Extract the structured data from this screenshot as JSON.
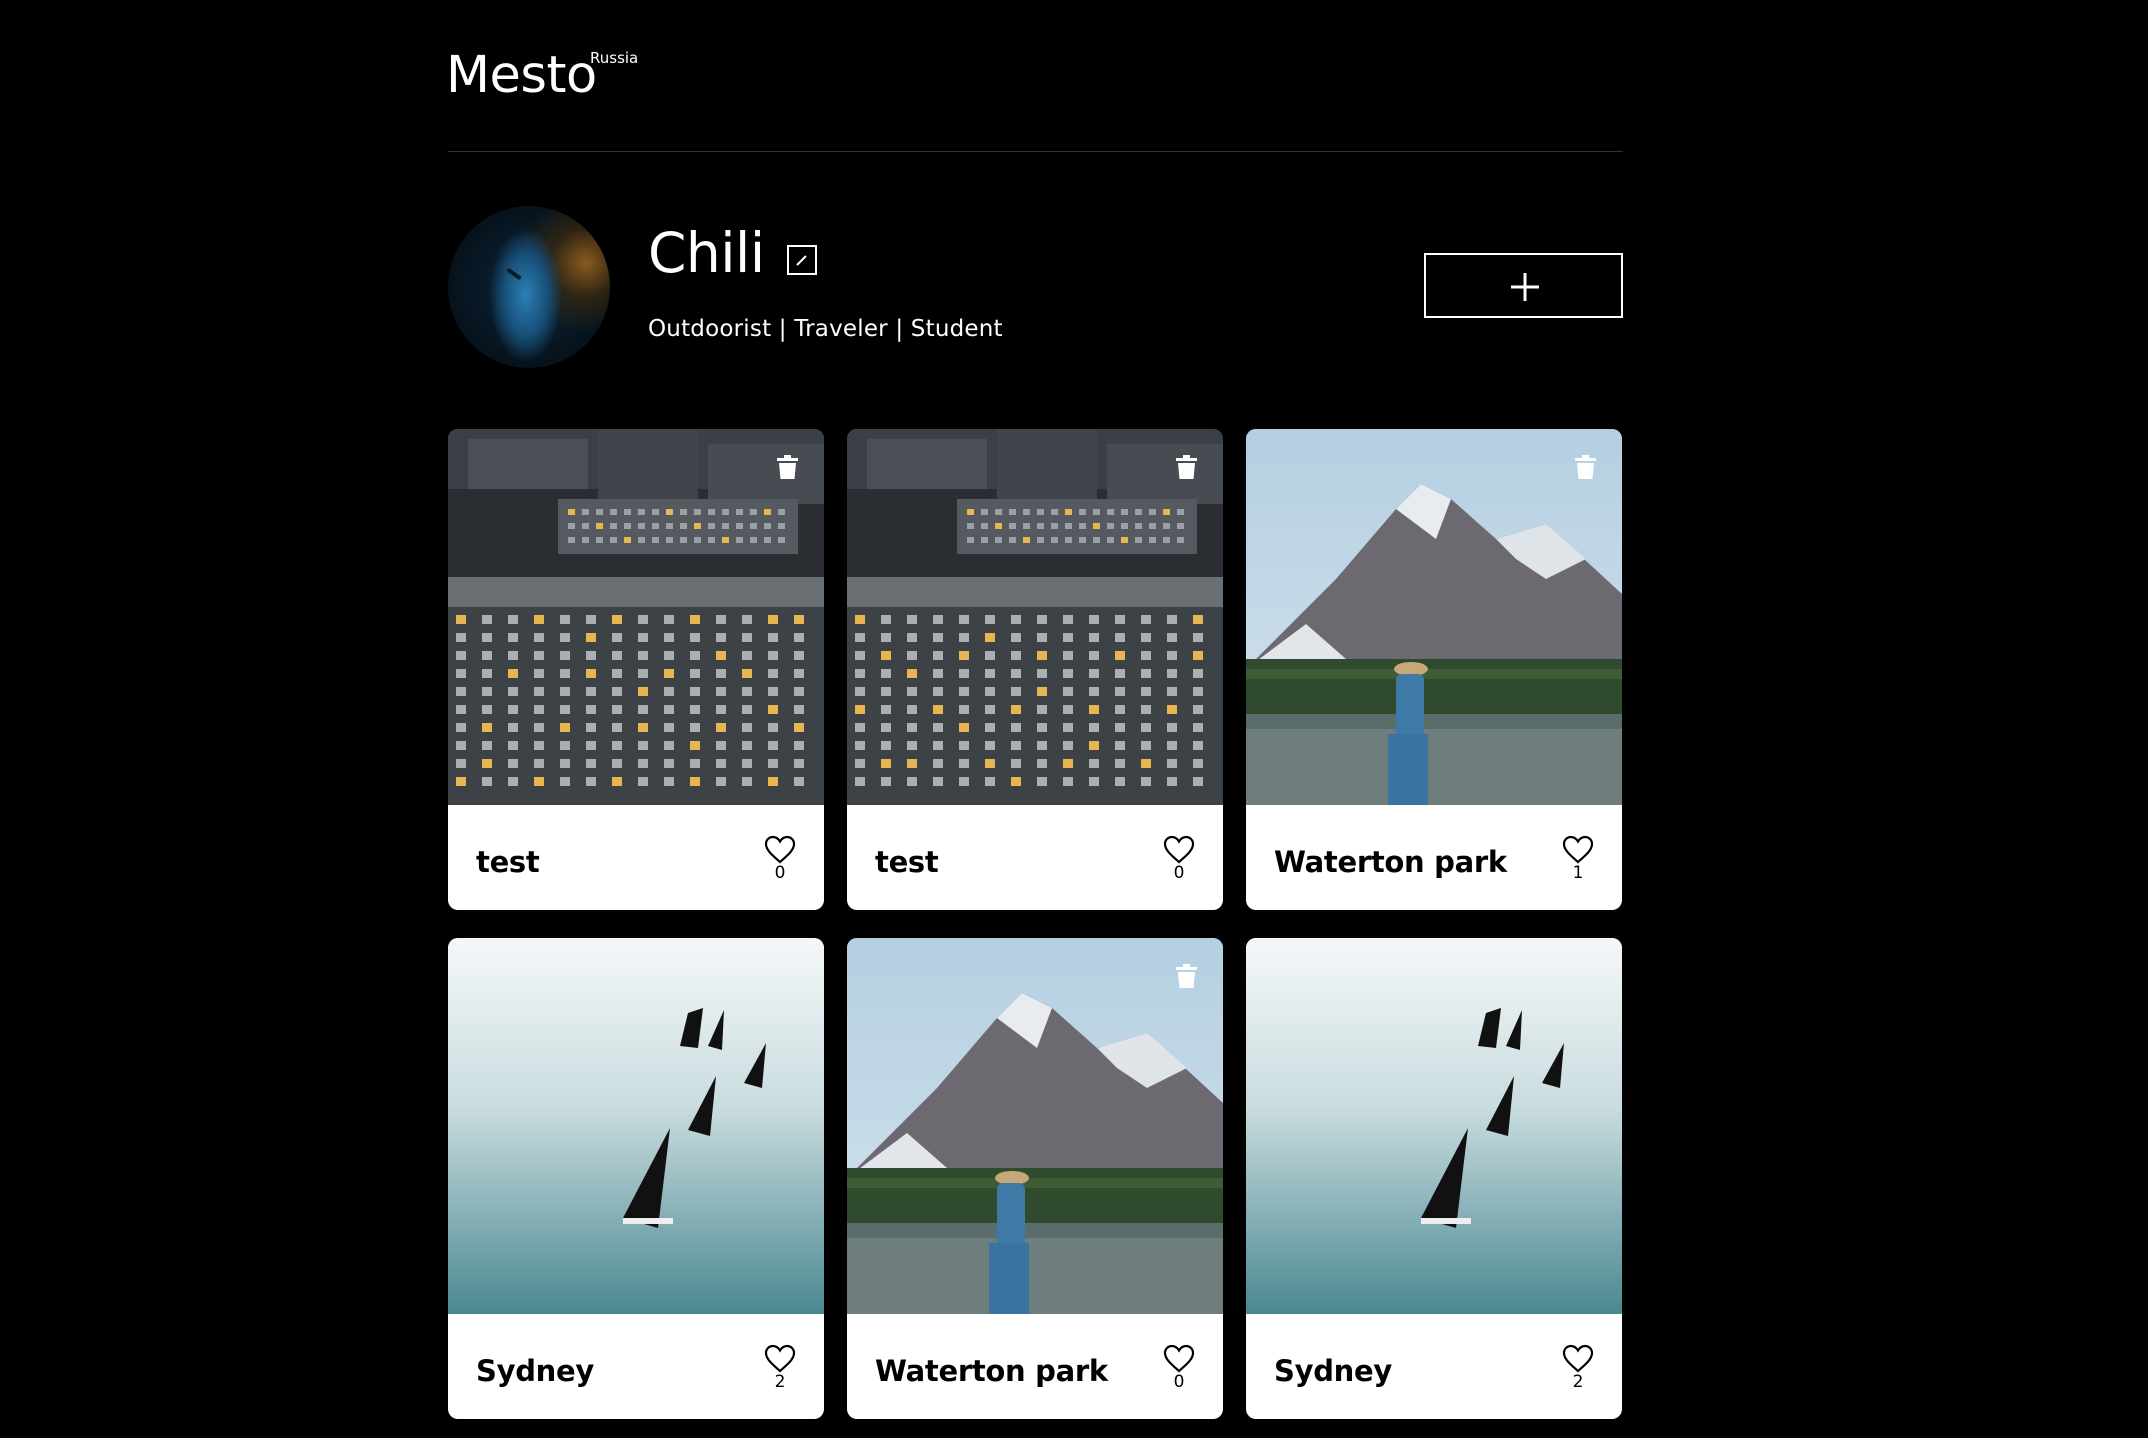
{
  "header": {
    "logo": "Mesto",
    "logo_sup": "Russia"
  },
  "profile": {
    "name": "Chili",
    "about": "Outdoorist | Traveler | Student"
  },
  "cards": [
    {
      "title": "test",
      "likes": "0",
      "image": "city-buildings",
      "deletable": true
    },
    {
      "title": "test",
      "likes": "0",
      "image": "city-buildings",
      "deletable": true
    },
    {
      "title": "Waterton park",
      "likes": "1",
      "image": "mountain-lake",
      "deletable": true
    },
    {
      "title": "Sydney",
      "likes": "2",
      "image": "sailboats",
      "deletable": false
    },
    {
      "title": "Waterton park",
      "likes": "0",
      "image": "mountain-lake",
      "deletable": true
    },
    {
      "title": "Sydney",
      "likes": "2",
      "image": "sailboats",
      "deletable": false
    }
  ],
  "icons": {
    "edit": "pencil-icon",
    "add": "plus-icon",
    "delete": "trash-icon",
    "like": "heart-icon"
  },
  "colors": {
    "background": "#000000",
    "card": "#ffffff",
    "text_dark": "#000000"
  }
}
